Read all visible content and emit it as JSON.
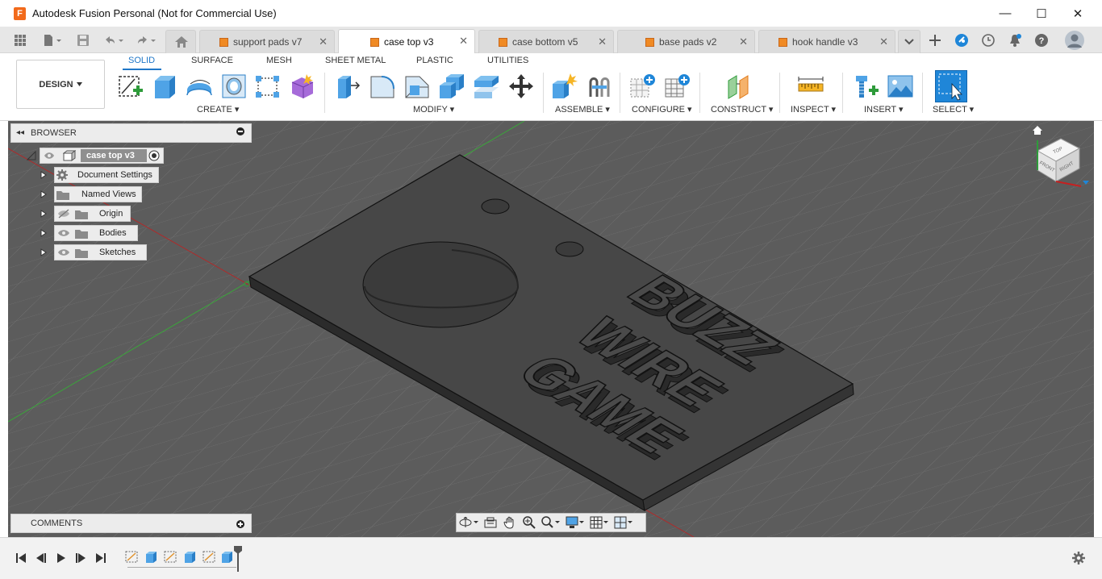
{
  "window": {
    "title": "Autodesk Fusion Personal (Not for Commercial Use)",
    "logo_letter": "F"
  },
  "window_controls": {
    "minimize": "—",
    "maximize": "☐",
    "close": "✕"
  },
  "tabs": [
    {
      "label": "support pads v7",
      "active": false
    },
    {
      "label": "case top v3",
      "active": true
    },
    {
      "label": "case bottom v5",
      "active": false
    },
    {
      "label": "base pads v2",
      "active": false
    },
    {
      "label": "hook handle v3",
      "active": false
    }
  ],
  "tab_close_glyph": "✕",
  "ribbon": {
    "workspace": "DESIGN",
    "tabs": [
      "SOLID",
      "SURFACE",
      "MESH",
      "SHEET METAL",
      "PLASTIC",
      "UTILITIES"
    ],
    "groups": [
      "CREATE ▾",
      "MODIFY ▾",
      "ASSEMBLE ▾",
      "CONFIGURE ▾",
      "CONSTRUCT ▾",
      "INSPECT ▾",
      "INSERT ▾",
      "SELECT ▾"
    ]
  },
  "browser": {
    "title": "BROWSER",
    "collapse_glyph": "◂◂",
    "root": "case top v3",
    "items": [
      "Document Settings",
      "Named Views",
      "Origin",
      "Bodies",
      "Sketches"
    ]
  },
  "comments": {
    "title": "COMMENTS"
  },
  "viewcube": {
    "top": "TOP",
    "front": "FRONT",
    "right": "RIGHT"
  },
  "model_text": [
    "BUZZ",
    "WIRE",
    "GAME"
  ],
  "colors": {
    "accent": "#1f77c8",
    "viewport_bg": "#5c5c5c",
    "body": "#3f3f3f",
    "tab_cube": "#f08a24"
  }
}
